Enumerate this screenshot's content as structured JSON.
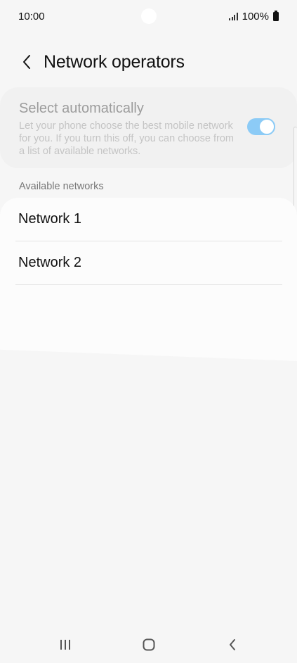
{
  "status_bar": {
    "time": "10:00",
    "battery": "100%"
  },
  "header": {
    "title": "Network operators",
    "back_icon": "chevron-left-icon"
  },
  "auto_select": {
    "title": "Select automatically",
    "description": "Let your phone choose the best mobile network for you. If you turn this off, you can choose from a list of available networks.",
    "enabled": true,
    "toggle_color": "#8ccbf6"
  },
  "available": {
    "header": "Available networks",
    "networks": [
      {
        "label": "Network 1"
      },
      {
        "label": "Network 2"
      }
    ]
  },
  "nav_bar": {
    "icons": [
      "recent-apps-icon",
      "home-icon",
      "back-icon"
    ]
  }
}
